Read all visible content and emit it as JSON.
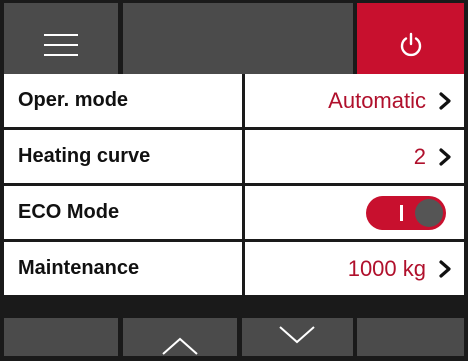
{
  "header": {
    "menu_icon": "hamburger-menu-icon",
    "power_icon": "power-icon",
    "accent": "#c8102e"
  },
  "settings": [
    {
      "label": "Oper. mode",
      "value": "Automatic"
    },
    {
      "label": "Heating curve",
      "value": "2"
    },
    {
      "label": "ECO Mode",
      "toggle_on": true
    },
    {
      "label": "Maintenance",
      "value": "1000 kg"
    }
  ],
  "footer": {
    "up_icon": "chevron-up-icon",
    "down_icon": "chevron-down-icon"
  }
}
